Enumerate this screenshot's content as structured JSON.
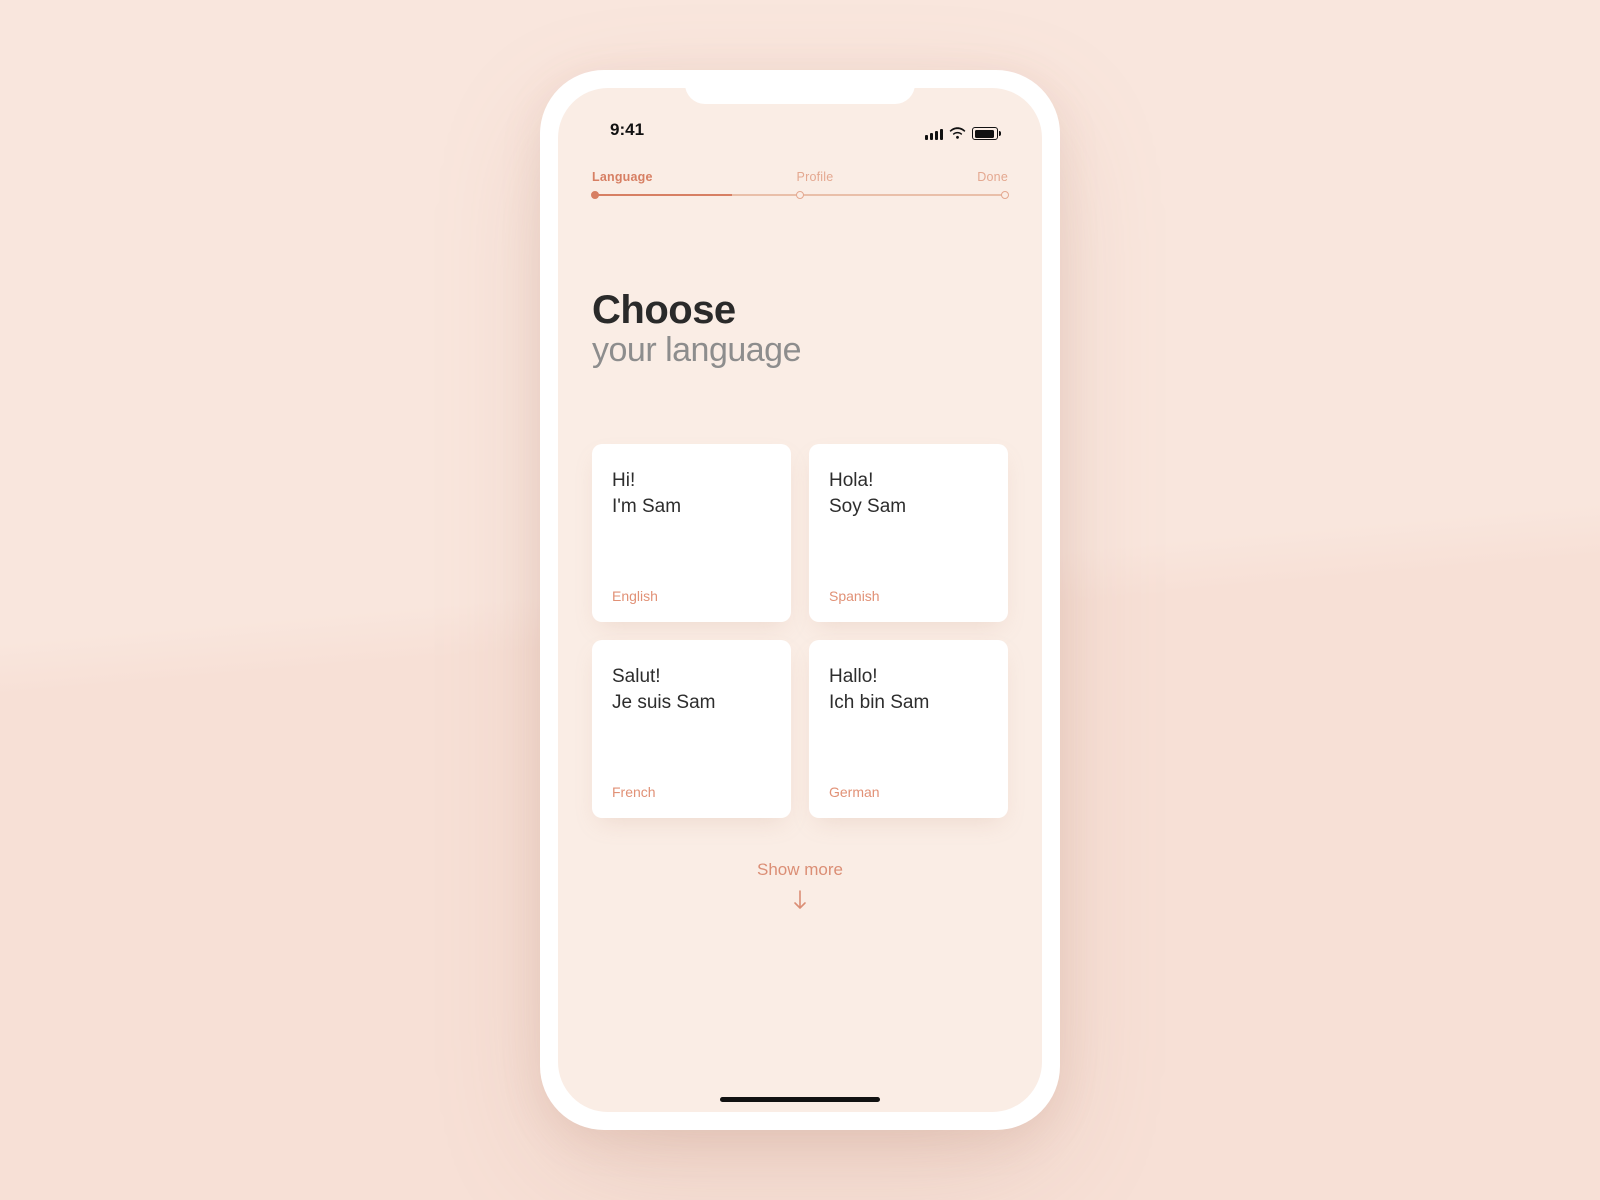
{
  "status": {
    "time": "9:41"
  },
  "stepper": {
    "steps": [
      "Language",
      "Profile",
      "Done"
    ],
    "activeIndex": 0,
    "fillPercent": 33
  },
  "heading": {
    "bold": "Choose",
    "light": "your language"
  },
  "cards": [
    {
      "line1": "Hi!",
      "line2": "I'm Sam",
      "lang": "English"
    },
    {
      "line1": "Hola!",
      "line2": "Soy Sam",
      "lang": "Spanish"
    },
    {
      "line1": "Salut!",
      "line2": "Je suis Sam",
      "lang": "French"
    },
    {
      "line1": "Hallo!",
      "line2": "Ich bin Sam",
      "lang": "German"
    }
  ],
  "showMore": "Show more",
  "colors": {
    "accent": "#d77f63",
    "accentLight": "#e4a890",
    "cardBg": "#ffffff",
    "screenBg": "#faede5"
  }
}
